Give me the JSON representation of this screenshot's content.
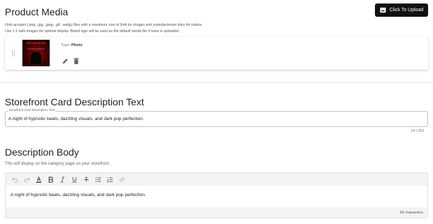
{
  "product_media": {
    "title": "Product Media",
    "upload_button": "Click To Upload",
    "hint_line1": "Only accepts (.png, .jpg, .jpeg, .gif, .webp) files with a maximum size of 2mb for images and youtube/vimeo links for videos.",
    "hint_line2": "Use 1:1 ratio images for optimal display. Brand logo will be used as the default media file if none is uploaded.",
    "item": {
      "type_label": "Type:",
      "type_value": "Photo",
      "thumb_title": "DEE VALENTINE",
      "thumb_sub": "HYPNOTIC NIGHTS"
    }
  },
  "storefront": {
    "title": "Storefront Card Description Text",
    "field_label": "Storefront Card Description Text",
    "field_value": "A night of hypnotic beats, dazzling visuals, and dark pop perfection.",
    "counter": "69 / 250"
  },
  "description_body": {
    "title": "Description Body",
    "subtitle": "This will display on the category page on your storefront.",
    "content": "A night of hypnotic beats, dazzling visuals, and dark pop perfection.",
    "char_count": "69 characters",
    "toolbar": [
      "undo-icon",
      "redo-icon",
      "text-color-icon",
      "bold-icon",
      "italic-icon",
      "underline-icon",
      "strikethrough-icon",
      "bulleted-list-icon",
      "numbered-list-icon",
      "link-icon"
    ]
  },
  "colors": {
    "button_bg": "#111111",
    "text_color_underline": "#111111"
  }
}
